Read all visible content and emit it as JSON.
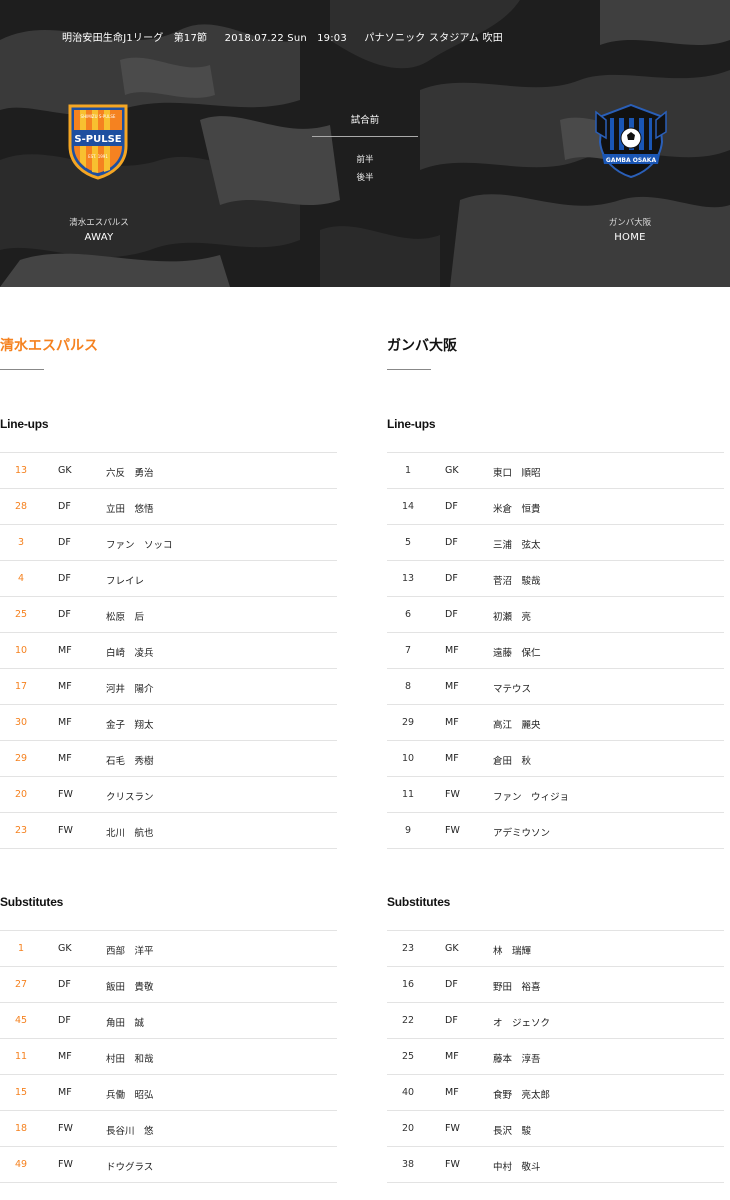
{
  "match": {
    "league": "明治安田生命J1リーグ　第17節",
    "date": "2018.07.22 Sun　19:03",
    "venue": "パナソニック スタジアム 吹田",
    "status": "試合前",
    "first_half": "前半",
    "second_half": "後半"
  },
  "away": {
    "name": "清水エスパルス",
    "role": "AWAY",
    "logo_text": "S-PULSE",
    "logo_small": "SHIMIZU S-PULSE",
    "logo_est": "EST. 1991"
  },
  "home": {
    "name": "ガンバ大阪",
    "role": "HOME",
    "logo_text": "GAMBA OSAKA"
  },
  "lineups_label": "Line-ups",
  "subs_label": "Substitutes",
  "away_lineup": [
    {
      "num": "13",
      "pos": "GK",
      "name": "六反　勇治"
    },
    {
      "num": "28",
      "pos": "DF",
      "name": "立田　悠悟"
    },
    {
      "num": "3",
      "pos": "DF",
      "name": "ファン　ソッコ"
    },
    {
      "num": "4",
      "pos": "DF",
      "name": "フレイレ"
    },
    {
      "num": "25",
      "pos": "DF",
      "name": "松原　后"
    },
    {
      "num": "10",
      "pos": "MF",
      "name": "白崎　凌兵"
    },
    {
      "num": "17",
      "pos": "MF",
      "name": "河井　陽介"
    },
    {
      "num": "30",
      "pos": "MF",
      "name": "金子　翔太"
    },
    {
      "num": "29",
      "pos": "MF",
      "name": "石毛　秀樹"
    },
    {
      "num": "20",
      "pos": "FW",
      "name": "クリスラン"
    },
    {
      "num": "23",
      "pos": "FW",
      "name": "北川　航也"
    }
  ],
  "away_subs": [
    {
      "num": "1",
      "pos": "GK",
      "name": "西部　洋平"
    },
    {
      "num": "27",
      "pos": "DF",
      "name": "飯田　貴敬"
    },
    {
      "num": "45",
      "pos": "DF",
      "name": "角田　誠"
    },
    {
      "num": "11",
      "pos": "MF",
      "name": "村田　和哉"
    },
    {
      "num": "15",
      "pos": "MF",
      "name": "兵働　昭弘"
    },
    {
      "num": "18",
      "pos": "FW",
      "name": "長谷川　悠"
    },
    {
      "num": "49",
      "pos": "FW",
      "name": "ドウグラス"
    }
  ],
  "home_lineup": [
    {
      "num": "1",
      "pos": "GK",
      "name": "東口　順昭"
    },
    {
      "num": "14",
      "pos": "DF",
      "name": "米倉　恒貴"
    },
    {
      "num": "5",
      "pos": "DF",
      "name": "三浦　弦太"
    },
    {
      "num": "13",
      "pos": "DF",
      "name": "菅沼　駿哉"
    },
    {
      "num": "6",
      "pos": "DF",
      "name": "初瀬　亮"
    },
    {
      "num": "7",
      "pos": "MF",
      "name": "遠藤　保仁"
    },
    {
      "num": "8",
      "pos": "MF",
      "name": "マテウス"
    },
    {
      "num": "29",
      "pos": "MF",
      "name": "高江　麗央"
    },
    {
      "num": "10",
      "pos": "MF",
      "name": "倉田　秋"
    },
    {
      "num": "11",
      "pos": "FW",
      "name": "ファン　ウィジョ"
    },
    {
      "num": "9",
      "pos": "FW",
      "name": "アデミウソン"
    }
  ],
  "home_subs": [
    {
      "num": "23",
      "pos": "GK",
      "name": "林　瑞輝"
    },
    {
      "num": "16",
      "pos": "DF",
      "name": "野田　裕喜"
    },
    {
      "num": "22",
      "pos": "DF",
      "name": "オ　ジェソク"
    },
    {
      "num": "25",
      "pos": "MF",
      "name": "藤本　淳吾"
    },
    {
      "num": "40",
      "pos": "MF",
      "name": "食野　亮太郎"
    },
    {
      "num": "20",
      "pos": "FW",
      "name": "長沢　駿"
    },
    {
      "num": "38",
      "pos": "FW",
      "name": "中村　敬斗"
    }
  ],
  "colors": {
    "accent_orange": "#f58220",
    "hero_dark": "#1c1c1c",
    "divider": "#e3e3e3"
  }
}
